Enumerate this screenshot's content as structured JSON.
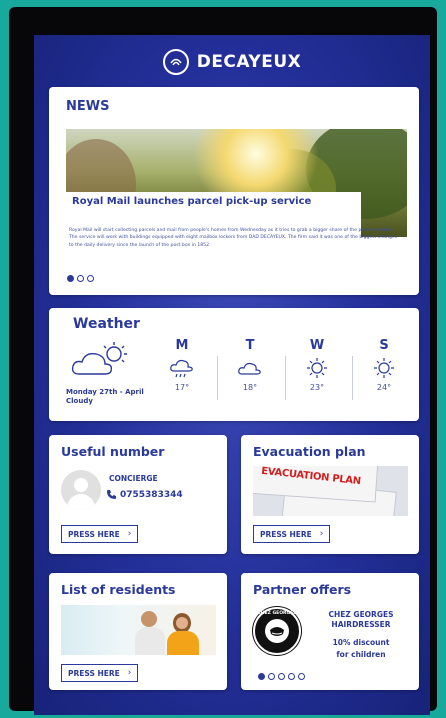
{
  "app": {
    "brand_name": "DECAYEUX",
    "logo_icon": "decayeux-logo-icon"
  },
  "colors": {
    "accent": "#2a3a9a",
    "background": "#232f98",
    "frame": "#17a99b"
  },
  "news": {
    "title": "NEWS",
    "headline": "Royal Mail launches parcel pick-up service",
    "body": "Royal Mail will start collecting parcels and mail from people's homes from Wednesday as it tries to grab a bigger share of the parcels market. The service will work with buildings equipped with eight mailbox lockers from DAD DECAYEUX. The firm said it was one of the biggest changes to the daily delivery since the launch of the post box in 1852.",
    "pager": {
      "count": 3,
      "active": 1
    }
  },
  "weather": {
    "title": "Weather",
    "today": {
      "date": "Monday 27th - April",
      "condition": "Cloudy",
      "icon": "partly-cloudy-icon"
    },
    "forecast": [
      {
        "day": "M",
        "temp": "17°",
        "icon": "rain-cloud-icon"
      },
      {
        "day": "T",
        "temp": "18°",
        "icon": "cloud-icon"
      },
      {
        "day": "W",
        "temp": "23°",
        "icon": "sun-icon"
      },
      {
        "day": "S",
        "temp": "24°",
        "icon": "sun-icon"
      }
    ]
  },
  "useful": {
    "title": "Useful number",
    "role": "CONCIERGE",
    "phone": "0755383344",
    "button": "PRESS HERE"
  },
  "evacuation": {
    "title": "Evacuation plan",
    "image_text": "EVACUATION PLAN",
    "button": "PRESS HERE"
  },
  "residents": {
    "title": "List of residents",
    "button": "PRESS HERE"
  },
  "partner": {
    "title": "Partner offers",
    "logo_text": "CHEZ GEORGES",
    "name_line1": "CHEZ GEORGES",
    "name_line2": "HAIRDRESSER",
    "offer_line1": "10% discount",
    "offer_line2": "for children",
    "pager": {
      "count": 5,
      "active": 1
    }
  }
}
